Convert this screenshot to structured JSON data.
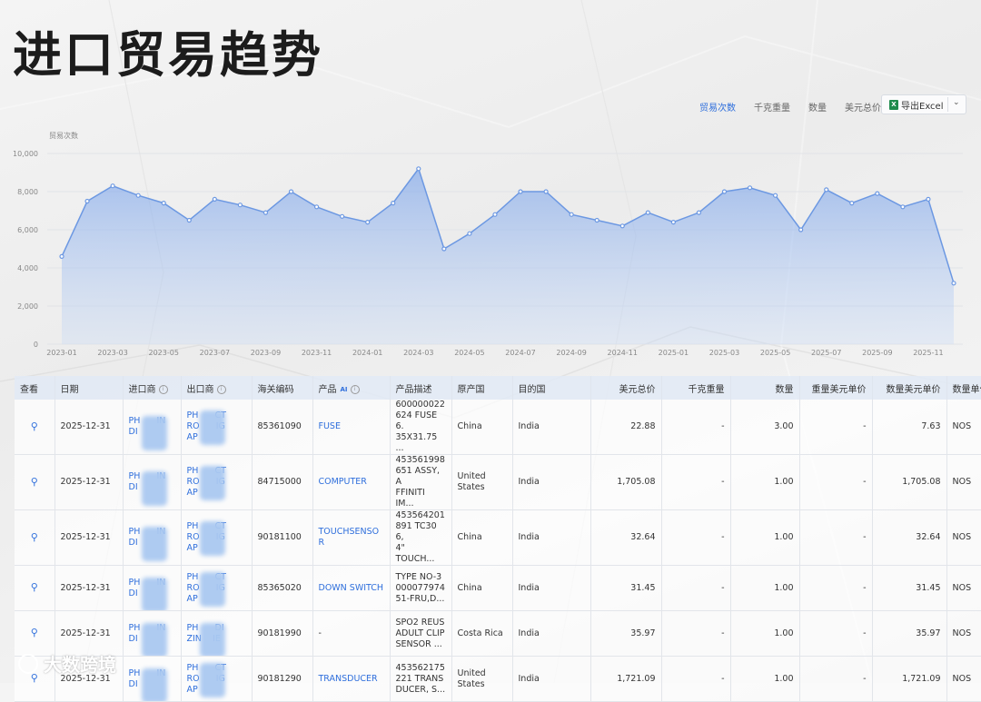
{
  "page_title": "进口贸易趋势",
  "metric_tabs": [
    {
      "label": "贸易次数",
      "active": true
    },
    {
      "label": "千克重量",
      "active": false
    },
    {
      "label": "数量",
      "active": false
    },
    {
      "label": "美元总价",
      "active": false
    }
  ],
  "export": {
    "label": "导出Excel",
    "icon": "excel-icon"
  },
  "chart_data": {
    "type": "area",
    "ylabel": "贸易次数",
    "ylim": [
      0,
      10000
    ],
    "yticks": [
      0,
      2000,
      4000,
      6000,
      8000,
      10000
    ],
    "ytick_labels": [
      "0",
      "2,000",
      "4,000",
      "6,000",
      "8,000",
      "10,000"
    ],
    "x": [
      "2023-01",
      "2023-02",
      "2023-03",
      "2023-04",
      "2023-05",
      "2023-06",
      "2023-07",
      "2023-08",
      "2023-09",
      "2023-10",
      "2023-11",
      "2023-12",
      "2024-01",
      "2024-02",
      "2024-03",
      "2024-04",
      "2024-05",
      "2024-06",
      "2024-07",
      "2024-08",
      "2024-09",
      "2024-10",
      "2024-11",
      "2024-12",
      "2025-01",
      "2025-02",
      "2025-03",
      "2025-04",
      "2025-05",
      "2025-06",
      "2025-07",
      "2025-08",
      "2025-09",
      "2025-10",
      "2025-11",
      "2025-12"
    ],
    "xtick_labels": [
      "2023-01",
      "2023-03",
      "2023-05",
      "2023-07",
      "2023-09",
      "2023-11",
      "2024-01",
      "2024-03",
      "2024-05",
      "2024-07",
      "2024-09",
      "2024-11",
      "2025-01",
      "2025-03",
      "2025-05",
      "2025-07",
      "2025-09",
      "2025-11"
    ],
    "values": [
      4600,
      7500,
      8300,
      7800,
      7400,
      6500,
      7600,
      7300,
      6900,
      8000,
      7200,
      6700,
      6400,
      7400,
      9200,
      5000,
      5800,
      6800,
      8000,
      8000,
      6800,
      6500,
      6200,
      6900,
      6400,
      6900,
      8000,
      8200,
      7800,
      6000,
      8100,
      7400,
      7900,
      7200,
      7600,
      3200
    ],
    "color": "#6c98e2",
    "grid": true
  },
  "table": {
    "columns": [
      "查看",
      "日期",
      "进口商",
      "出口商",
      "海关编码",
      "产品",
      "产品描述",
      "原产国",
      "目的国",
      "美元总价",
      "千克重量",
      "数量",
      "重量美元单价",
      "数量美元单价",
      "数量单位"
    ],
    "ai_badge": "AI",
    "rows": [
      {
        "date": "2025-12-31",
        "importer": [
          "PH",
          "IN",
          "DI"
        ],
        "exporter": [
          "PH",
          "CT",
          "RO",
          "IG",
          "AP"
        ],
        "hs": "85361090",
        "product": "FUSE",
        "desc": [
          "600000022",
          "624 FUSE 6.",
          "35X31.75 ..."
        ],
        "origin": "China",
        "dest": "India",
        "usd": "22.88",
        "kg": "-",
        "qty": "3.00",
        "kg_price": "-",
        "unit_price": "7.63",
        "unit": "NOS"
      },
      {
        "date": "2025-12-31",
        "importer": [
          "PH",
          "IN",
          "DI"
        ],
        "exporter": [
          "PH",
          "CT",
          "RO",
          "IG",
          "AP"
        ],
        "hs": "84715000",
        "product": "COMPUTER",
        "desc": [
          "453561998",
          "651 ASSY, A",
          "FFINITI IM..."
        ],
        "origin": "United States",
        "dest": "India",
        "usd": "1,705.08",
        "kg": "-",
        "qty": "1.00",
        "kg_price": "-",
        "unit_price": "1,705.08",
        "unit": "NOS"
      },
      {
        "date": "2025-12-31",
        "importer": [
          "PH",
          "IN",
          "DI"
        ],
        "exporter": [
          "PH",
          "CT",
          "RO",
          "IG",
          "AP"
        ],
        "hs": "90181100",
        "product": "TOUCHSENSOR",
        "desc": [
          "453564201",
          "891 TC30 6,",
          "4\" TOUCH..."
        ],
        "origin": "China",
        "dest": "India",
        "usd": "32.64",
        "kg": "-",
        "qty": "1.00",
        "kg_price": "-",
        "unit_price": "32.64",
        "unit": "NOS"
      },
      {
        "date": "2025-12-31",
        "importer": [
          "PH",
          "IN",
          "DI"
        ],
        "exporter": [
          "PH",
          "CT",
          "RO",
          "IG",
          "AP"
        ],
        "hs": "85365020",
        "product": "DOWN SWITCH",
        "desc": [
          "TYPE NO-3",
          "000077974",
          "51-FRU,D..."
        ],
        "origin": "China",
        "dest": "India",
        "usd": "31.45",
        "kg": "-",
        "qty": "1.00",
        "kg_price": "-",
        "unit_price": "31.45",
        "unit": "NOS"
      },
      {
        "date": "2025-12-31",
        "importer": [
          "PH",
          "IN",
          "DI"
        ],
        "exporter": [
          "PH",
          "DI",
          "ZIN",
          "IE"
        ],
        "hs": "90181990",
        "product": "-",
        "desc": [
          "SPO2 REUS",
          "ADULT CLIP",
          "SENSOR ..."
        ],
        "origin": "Costa Rica",
        "dest": "India",
        "usd": "35.97",
        "kg": "-",
        "qty": "1.00",
        "kg_price": "-",
        "unit_price": "35.97",
        "unit": "NOS"
      },
      {
        "date": "2025-12-31",
        "importer": [
          "PH",
          "IN",
          "DI"
        ],
        "exporter": [
          "PH",
          "CT",
          "RO",
          "IG",
          "AP"
        ],
        "hs": "90181290",
        "product": "TRANSDUCER",
        "desc": [
          "453562175",
          "221 TRANS",
          "DUCER, S..."
        ],
        "origin": "United States",
        "dest": "India",
        "usd": "1,721.09",
        "kg": "-",
        "qty": "1.00",
        "kg_price": "-",
        "unit_price": "1,721.09",
        "unit": "NOS"
      }
    ]
  },
  "watermark": "大数跨境"
}
